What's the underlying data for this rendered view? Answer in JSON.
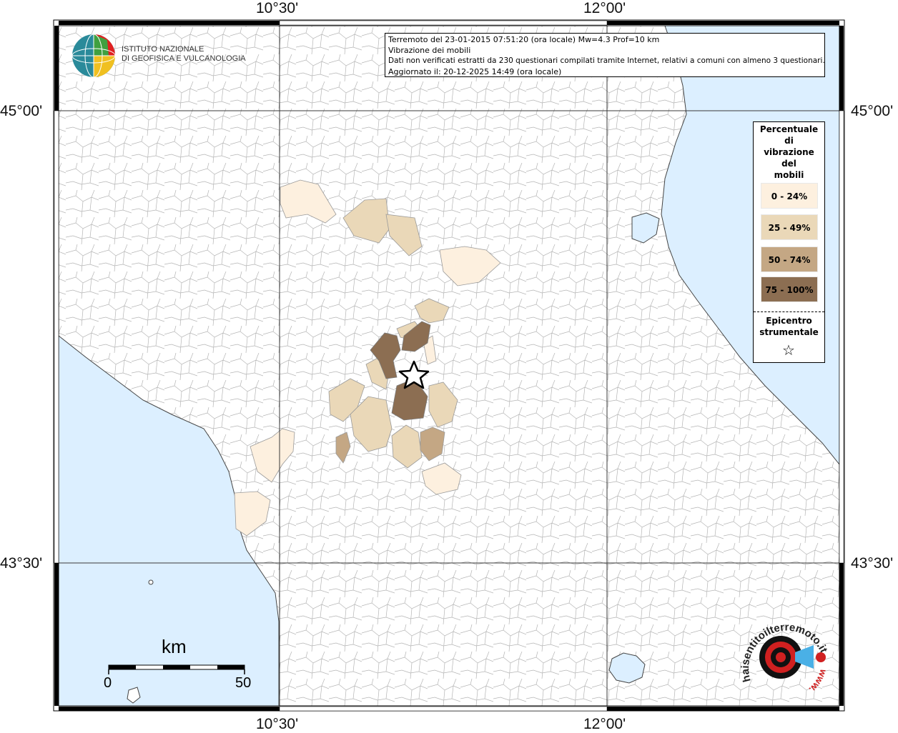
{
  "map": {
    "lon_labels": [
      "10°30'",
      "12°00'"
    ],
    "lat_labels": [
      "45°00'",
      "43°30'"
    ]
  },
  "info": {
    "line1": "Terremoto del 23-01-2015 07:51:20 (ora locale) Mw=4.3 Prof=10 km",
    "line2": "Vibrazione dei mobili",
    "line3": "Dati non verificati estratti da 230 questionari compilati tramite Internet, relativi a comuni con almeno 3 questionari.",
    "line4": "Aggiornato il: 20-12-2025 14:49 (ora locale)"
  },
  "logo": {
    "line1": "ISTITUTO NAZIONALE",
    "line2": "DI GEOFISICA E VULCANOLOGIA",
    "icon": "ingv-globe-logo"
  },
  "legend": {
    "title": [
      "Percentuale",
      "di",
      "vibrazione",
      "del",
      "mobili"
    ],
    "items": [
      {
        "label": "0 - 24%",
        "color": "#fdf0df"
      },
      {
        "label": "25 - 49%",
        "color": "#ead8b8"
      },
      {
        "label": "50 - 74%",
        "color": "#c4a784"
      },
      {
        "label": "75 - 100%",
        "color": "#8c6e52"
      }
    ],
    "epicenter_label": [
      "Epicentro",
      "strumentale"
    ],
    "epicenter_icon": "star-icon"
  },
  "scale": {
    "title": "km",
    "min": "0",
    "max": "50"
  },
  "watermark": {
    "text": "haisentitoilterremoto.it",
    "url_text": "www.",
    "icon": "target-megaphone-logo"
  },
  "colors": {
    "sea": "#dcefff",
    "land": "#ffffff",
    "borders": "#b0b0b0",
    "grid": "#3a3a3a"
  }
}
